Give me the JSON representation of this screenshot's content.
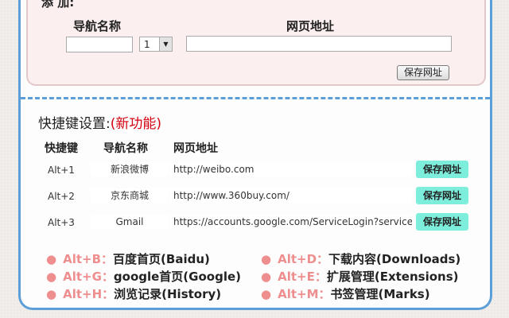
{
  "add": {
    "title": "添 加:",
    "col_name": "导航名称",
    "col_url": "网页地址",
    "name_value": "",
    "url_value": "",
    "select_value": "1",
    "save_label": "保存网址"
  },
  "shortcuts": {
    "title": "快捷键设置:",
    "new_tag": "(新功能)",
    "headers": [
      "快捷键",
      "导航名称",
      "网页地址"
    ],
    "rows": [
      {
        "key": "Alt+1",
        "name": "新浪微博",
        "url": "http://weibo.com",
        "save": "保存网址"
      },
      {
        "key": "Alt+2",
        "name": "京东商城",
        "url": "http://www.360buy.com/",
        "save": "保存网址"
      },
      {
        "key": "Alt+3",
        "name": "Gmail",
        "url": "https://accounts.google.com/ServiceLogin?service=mail",
        "save": "保存网址"
      }
    ]
  },
  "tips": [
    {
      "key": "Alt+B：",
      "desc": "百度首页(Baidu)"
    },
    {
      "key": "Alt+D：",
      "desc": "下载内容(Downloads)"
    },
    {
      "key": "Alt+G：",
      "desc": "google首页(Google)"
    },
    {
      "key": "Alt+E：",
      "desc": "扩展管理(Extensions)"
    },
    {
      "key": "Alt+H：",
      "desc": "浏览记录(History)"
    },
    {
      "key": "Alt+M：",
      "desc": "书签管理(Marks)"
    }
  ],
  "colors": {
    "accent_blue": "#5c9fd8",
    "new_red": "#d4000f",
    "save_green": "#7eeedc",
    "tip_pink": "#ef8e8e"
  }
}
